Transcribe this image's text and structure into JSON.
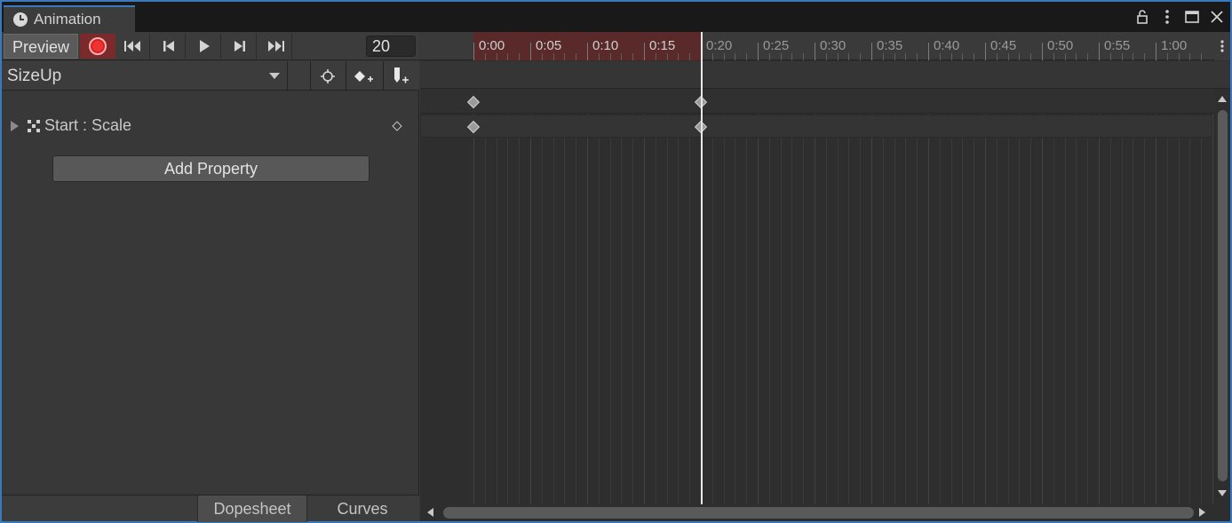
{
  "window": {
    "tab_title": "Animation",
    "icons": [
      "clock-icon",
      "lock-icon",
      "kebab-menu-icon",
      "maximize-icon",
      "close-icon"
    ],
    "accent_color": "#3a79bb"
  },
  "toolbar": {
    "preview_label": "Preview",
    "record_color": "#ee3333",
    "frame_value": "20",
    "buttons": [
      "record-icon",
      "first-key-icon",
      "prev-key-icon",
      "play-icon",
      "next-key-icon",
      "last-key-icon"
    ]
  },
  "clip": {
    "name": "SizeUp",
    "tools": [
      "filter-by-selection-icon",
      "add-keyframe-icon",
      "add-event-icon"
    ]
  },
  "properties": [
    {
      "label": "Start : Scale",
      "icon": "rect-transform-icon"
    }
  ],
  "add_property_label": "Add Property",
  "bottom_tabs": {
    "dopesheet": "Dopesheet",
    "curves": "Curves",
    "active": "dopesheet"
  },
  "timeline": {
    "tick_labels": [
      "0:00",
      "0:05",
      "0:10",
      "0:15",
      "0:20",
      "0:25",
      "0:30",
      "0:35",
      "0:40",
      "0:45",
      "0:50",
      "0:55",
      "1:00"
    ],
    "recording_range_end": "0:20",
    "playhead_frame": 20,
    "keyframes_frames": [
      0,
      20
    ]
  }
}
